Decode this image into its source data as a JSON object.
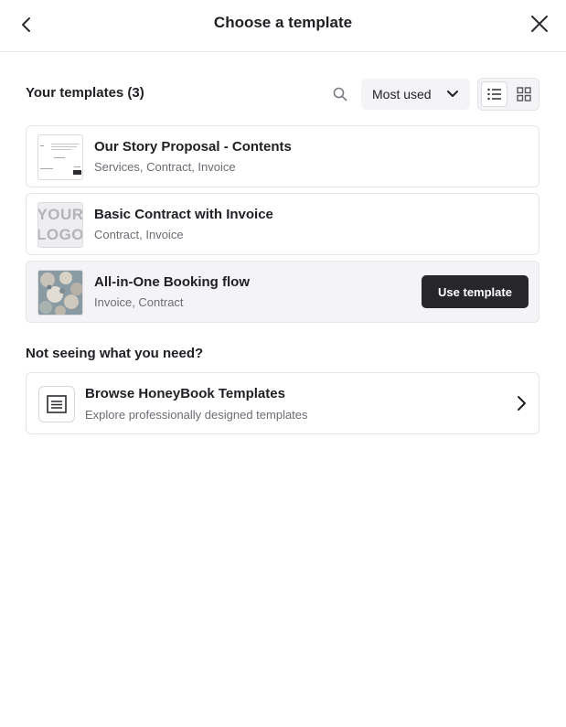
{
  "header": {
    "title": "Choose a template"
  },
  "templates": {
    "section_title": "Your templates (3)",
    "sort": {
      "selected": "Most used"
    },
    "view_mode": "list",
    "items": [
      {
        "title": "Our Story Proposal - Contents",
        "tags": "Services, Contract, Invoice"
      },
      {
        "title": "Basic Contract with Invoice",
        "tags": "Contract, Invoice",
        "thumb_logo_line1": "YOUR",
        "thumb_logo_line2": "LOGO"
      },
      {
        "title": "All-in-One Booking flow",
        "tags": "Invoice, Contract",
        "action_label": "Use template"
      }
    ]
  },
  "browse": {
    "heading": "Not seeing what you need?",
    "title": "Browse HoneyBook Templates",
    "subtitle": "Explore professionally designed templates"
  },
  "colors": {
    "primary_button": "#26262b",
    "text": "#1f1f24",
    "muted_text": "#6c6c74",
    "surface": "#f4f4f6"
  }
}
